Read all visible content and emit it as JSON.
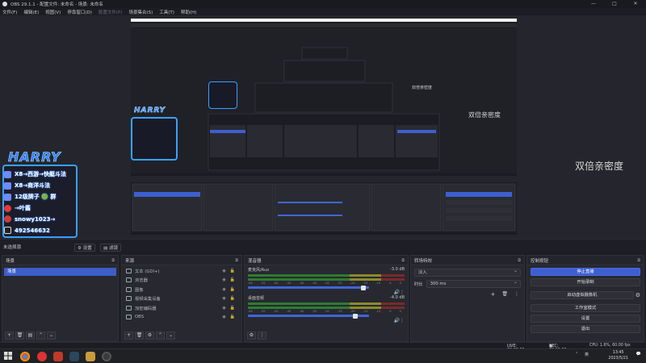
{
  "window": {
    "title": "OBS 29.1.1 - 配置文件: 未命名 - 场景: 未命名",
    "controls": [
      "—",
      "□",
      "✕"
    ]
  },
  "menu": [
    "文件(F)",
    "编辑(E)",
    "视图(V)",
    "停靠窗口(D)",
    "配置文件(P)",
    "场景集合(S)",
    "工具(T)",
    "帮助(H)"
  ],
  "preview": {
    "text_large": "双倍亲密度",
    "text_medium": "双倍亲密度",
    "text_small": "双倍亲密度",
    "overlay": {
      "logo_text": "HARRY",
      "lines": [
        {
          "text": "X8→西游→快艇斗法",
          "icon": "video-icon",
          "color": "#6c8cff"
        },
        {
          "text": "X8→商洋斗法",
          "icon": "video-icon",
          "color": "#6c8cff"
        },
        {
          "text": "12级牌子 🟢 群",
          "icon": "level-icon",
          "color": "#6c8cff"
        },
        {
          "text": "→叶酱",
          "icon": "weibo-icon",
          "color": "#e23a3a"
        },
        {
          "text": "snowy1023→",
          "icon": "douyin-icon",
          "color": "#cc3b3b"
        },
        {
          "text": "492546632",
          "icon": "qq-icon",
          "color": "#222"
        }
      ]
    }
  },
  "docks_tabs": {
    "scene_transition_label": "未选择源",
    "settings_label": "设置",
    "filters_label": "滤镜"
  },
  "scenes": {
    "title": "场景",
    "items": [
      "场景"
    ],
    "selected": 0
  },
  "sources": {
    "title": "来源",
    "items": [
      {
        "name": "文本 (GDI+)",
        "icon": "text-icon"
      },
      {
        "name": "浏览器",
        "icon": "browser-icon"
      },
      {
        "name": "图像",
        "icon": "image-icon"
      },
      {
        "name": "视频采集设备",
        "icon": "camera-icon"
      },
      {
        "name": "加密编码器",
        "icon": "source-icon"
      },
      {
        "name": "OBS",
        "icon": "source-icon"
      }
    ]
  },
  "mixer": {
    "title": "混音器",
    "channels": [
      {
        "name": "麦克风/Aux",
        "db": "-3.0 dB",
        "level": 0.78
      },
      {
        "name": "桌面音频",
        "db": "-4.0 dB",
        "level": 0.72
      }
    ],
    "ticks": [
      "-60",
      "-55",
      "-50",
      "-45",
      "-40",
      "-35",
      "-30",
      "-25",
      "-20",
      "-15",
      "-10",
      "-5",
      "0"
    ]
  },
  "transitions": {
    "title": "转场特效",
    "selected": "淡入",
    "duration_label": "时长",
    "duration_value": "300 ms"
  },
  "controls": {
    "title": "控制按钮",
    "buttons": [
      "停止直播",
      "开始录制",
      "启动虚拟摄像机",
      "工作室模式",
      "设置",
      "退出"
    ]
  },
  "status": {
    "live": "LIVE: 00:00:00",
    "rec": "REC: 00:00:00",
    "cpu": "CPU: 1.6%, 60.00 fps"
  },
  "taskbar": {
    "time": "13:45",
    "date": "2023/5/21",
    "ime": "英"
  },
  "colors": {
    "accent": "#3d5fd0",
    "overlay_border": "#3aa0ff"
  }
}
